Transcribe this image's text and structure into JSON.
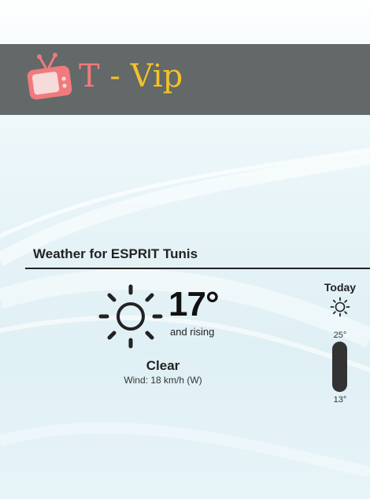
{
  "app": {
    "logo_text_t": "T",
    "logo_text_dash": "-",
    "logo_text_vip": "Vip",
    "icon": "tv-icon",
    "colors": {
      "header": "#636868",
      "logo_pink": "#f07a7c",
      "logo_yellow": "#f2c22a"
    }
  },
  "weather": {
    "title": "Weather for ESPRIT Tunis",
    "current": {
      "icon": "sun-icon",
      "temperature": "17°",
      "trend": "and rising",
      "condition": "Clear",
      "wind": "Wind: 18 km/h (W)"
    },
    "today": {
      "label": "Today",
      "icon": "sun-icon",
      "high": "25°",
      "low": "13°"
    }
  }
}
